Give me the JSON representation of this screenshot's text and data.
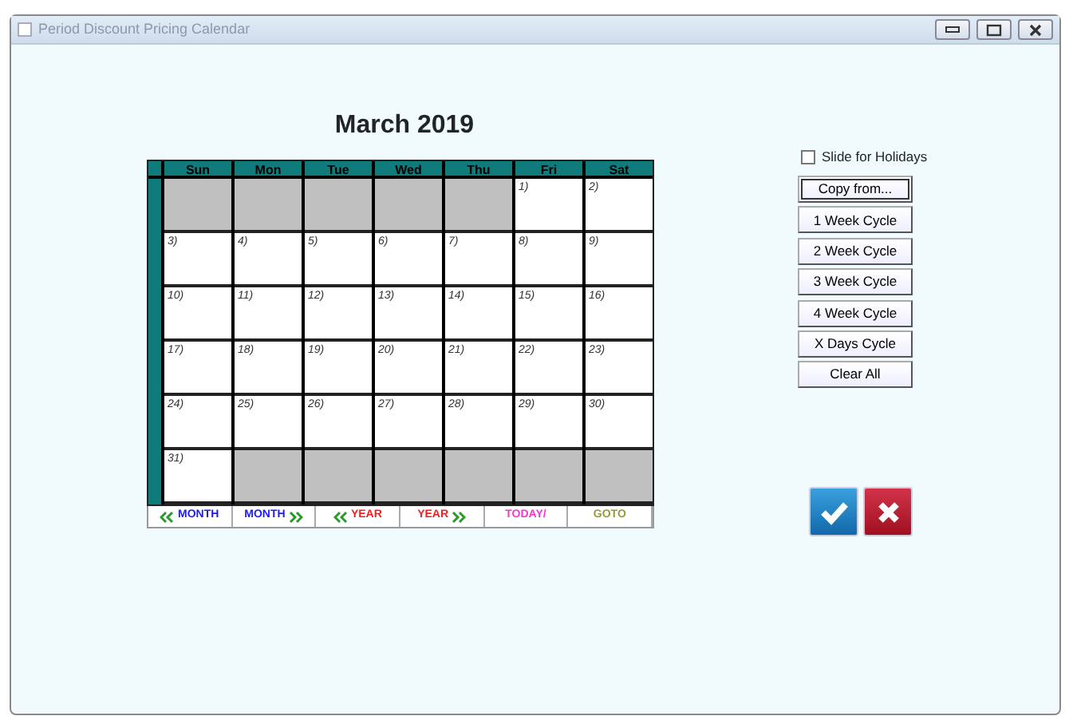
{
  "window": {
    "title": "Period Discount Pricing Calendar"
  },
  "calendar": {
    "title": "March 2019",
    "weekdays": [
      "Sun",
      "Mon",
      "Tue",
      "Wed",
      "Thu",
      "Fri",
      "Sat"
    ],
    "weeks": [
      [
        {
          "kind": "blank"
        },
        {
          "kind": "blank"
        },
        {
          "kind": "blank"
        },
        {
          "kind": "blank"
        },
        {
          "kind": "blank"
        },
        {
          "kind": "day",
          "day": "1)"
        },
        {
          "kind": "day",
          "day": "2)"
        }
      ],
      [
        {
          "kind": "day",
          "day": "3)"
        },
        {
          "kind": "day",
          "day": "4)"
        },
        {
          "kind": "day",
          "day": "5)"
        },
        {
          "kind": "day",
          "day": "6)"
        },
        {
          "kind": "day",
          "day": "7)"
        },
        {
          "kind": "day",
          "day": "8)"
        },
        {
          "kind": "day",
          "day": "9)"
        }
      ],
      [
        {
          "kind": "day",
          "day": "10)"
        },
        {
          "kind": "day",
          "day": "11)"
        },
        {
          "kind": "day",
          "day": "12)"
        },
        {
          "kind": "day",
          "day": "13)"
        },
        {
          "kind": "day",
          "day": "14)"
        },
        {
          "kind": "day",
          "day": "15)"
        },
        {
          "kind": "day",
          "day": "16)"
        }
      ],
      [
        {
          "kind": "day",
          "day": "17)"
        },
        {
          "kind": "day",
          "day": "18)"
        },
        {
          "kind": "day",
          "day": "19)"
        },
        {
          "kind": "day",
          "day": "20)"
        },
        {
          "kind": "day",
          "day": "21)"
        },
        {
          "kind": "day",
          "day": "22)"
        },
        {
          "kind": "day",
          "day": "23)"
        }
      ],
      [
        {
          "kind": "day",
          "day": "24)"
        },
        {
          "kind": "day",
          "day": "25)"
        },
        {
          "kind": "day",
          "day": "26)"
        },
        {
          "kind": "day",
          "day": "27)"
        },
        {
          "kind": "day",
          "day": "28)"
        },
        {
          "kind": "day",
          "day": "29)"
        },
        {
          "kind": "day",
          "day": "30)"
        }
      ],
      [
        {
          "kind": "day",
          "day": "31)"
        },
        {
          "kind": "blank"
        },
        {
          "kind": "blank"
        },
        {
          "kind": "blank"
        },
        {
          "kind": "blank"
        },
        {
          "kind": "blank"
        },
        {
          "kind": "blank"
        }
      ]
    ],
    "nav": [
      {
        "label": "MONTH",
        "kind": "back",
        "color": "#1a1aff"
      },
      {
        "label": "MONTH",
        "kind": "forward",
        "color": "#1a1aff"
      },
      {
        "label": "YEAR",
        "kind": "back",
        "color": "#ff1a1a"
      },
      {
        "label": "YEAR",
        "kind": "forward",
        "color": "#ff1a1a"
      },
      {
        "label": "TODAY/",
        "kind": "plain",
        "color": "#ff33cc"
      },
      {
        "label": "GOTO",
        "kind": "plain",
        "color": "#999933"
      }
    ]
  },
  "options": {
    "slide_for_holidays": {
      "label": "Slide for Holidays",
      "checked": false
    },
    "buttons": [
      {
        "label": "Copy from...",
        "focused": true
      },
      {
        "label": "1 Week Cycle",
        "focused": false
      },
      {
        "label": "2 Week Cycle",
        "focused": false
      },
      {
        "label": "3 Week Cycle",
        "focused": false
      },
      {
        "label": "4 Week Cycle",
        "focused": false
      },
      {
        "label": "X Days Cycle",
        "focused": false
      },
      {
        "label": "Clear All",
        "focused": false
      }
    ]
  }
}
